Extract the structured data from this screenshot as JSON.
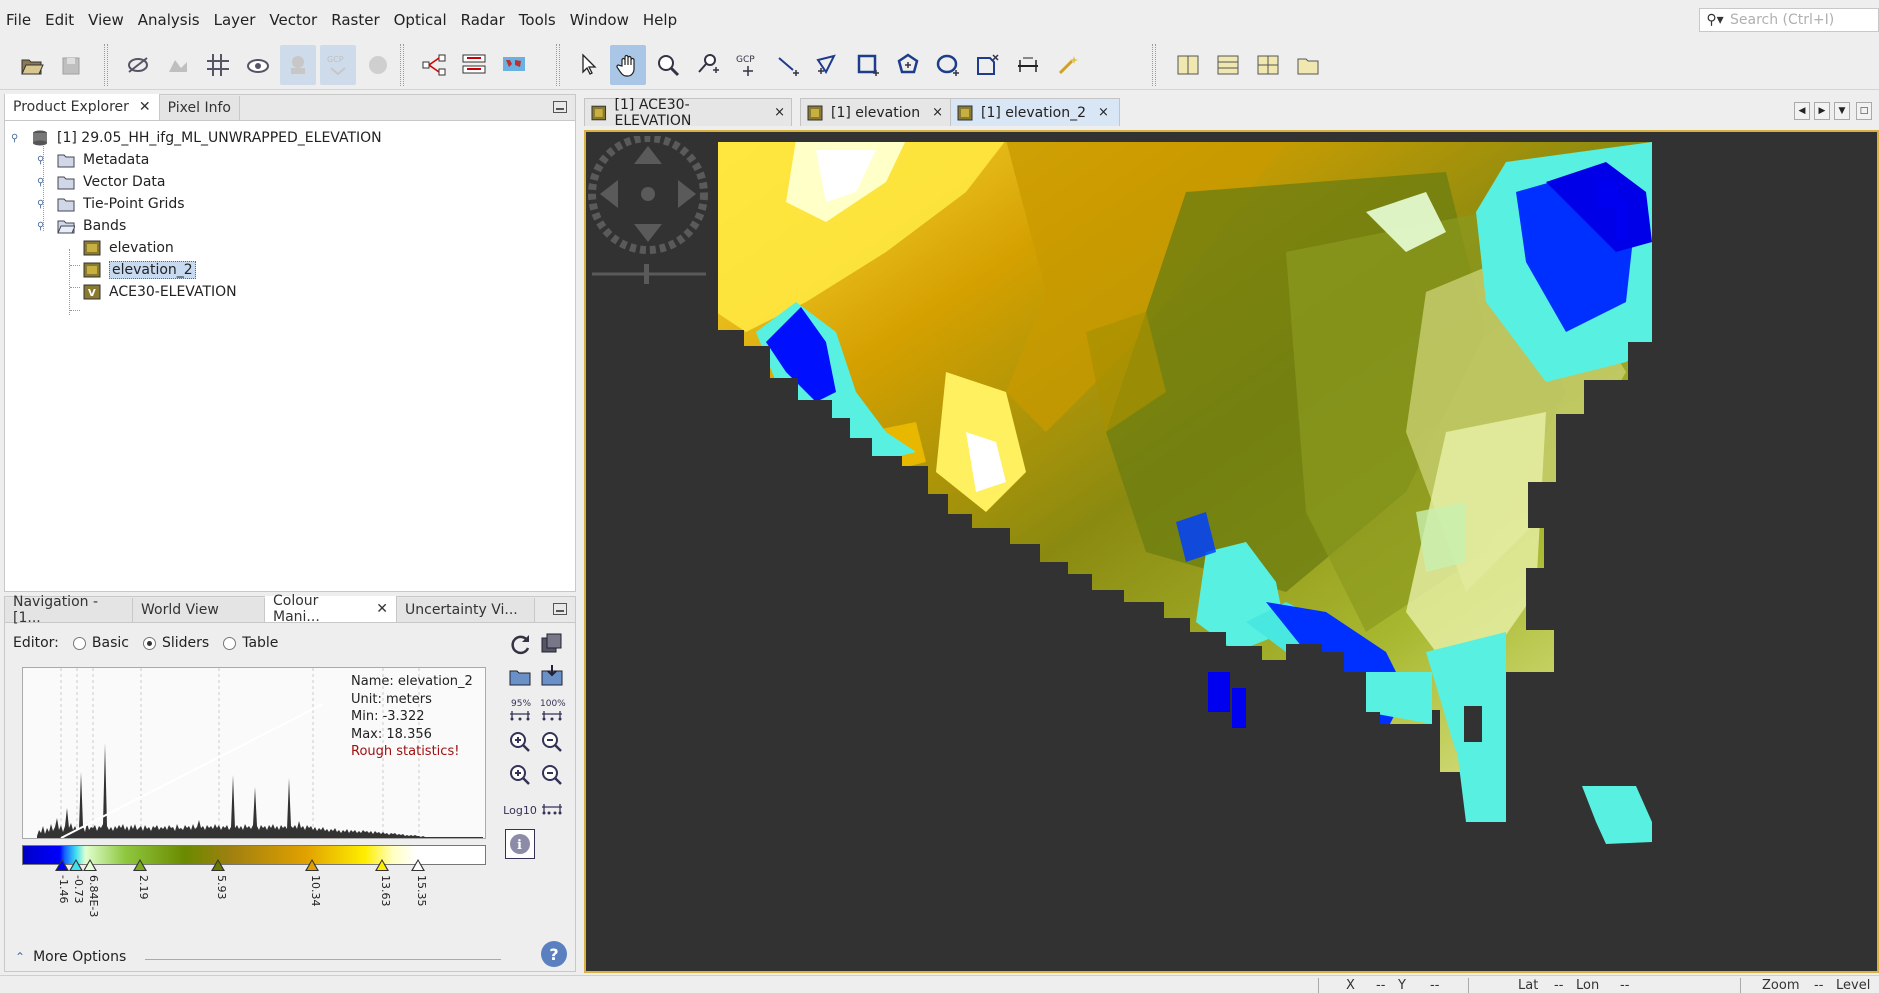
{
  "menubar": {
    "items": [
      {
        "label": "File"
      },
      {
        "label": "Edit"
      },
      {
        "label": "View"
      },
      {
        "label": "Analysis"
      },
      {
        "label": "Layer"
      },
      {
        "label": "Vector"
      },
      {
        "label": "Raster"
      },
      {
        "label": "Optical"
      },
      {
        "label": "Radar"
      },
      {
        "label": "Tools"
      },
      {
        "label": "Window"
      },
      {
        "label": "Help"
      }
    ],
    "search_placeholder": "Search (Ctrl+I)"
  },
  "explorer": {
    "tabs": [
      {
        "label": "Product Explorer"
      },
      {
        "label": "Pixel Info"
      }
    ],
    "product": "[1] 29.05_HH_ifg_ML_UNWRAPPED_ELEVATION",
    "folders": [
      {
        "label": "Metadata"
      },
      {
        "label": "Vector Data"
      },
      {
        "label": "Tie-Point Grids"
      },
      {
        "label": "Bands"
      }
    ],
    "bands": [
      {
        "label": "elevation"
      },
      {
        "label": "elevation_2"
      },
      {
        "label": "ACE30-ELEVATION"
      }
    ]
  },
  "lower_panel": {
    "tabs": [
      {
        "label": "Navigation - [1..."
      },
      {
        "label": "World View"
      },
      {
        "label": "Colour Mani..."
      },
      {
        "label": "Uncertainty Vi..."
      }
    ],
    "editor_label": "Editor:",
    "editor_options": [
      {
        "label": "Basic"
      },
      {
        "label": "Sliders"
      },
      {
        "label": "Table"
      }
    ],
    "editor_selected": "Sliders",
    "info": {
      "name": "Name: elevation_2",
      "unit": "Unit: meters",
      "min": "Min: -3.322",
      "max": "Max: 18.356",
      "warning": "Rough statistics!"
    },
    "sliders": [
      {
        "label": "-1.46",
        "color": "#0000ff"
      },
      {
        "label": "-0.73",
        "color": "#40e0f0"
      },
      {
        "label": "6.84E-3",
        "color": "#e8ffd8"
      },
      {
        "label": "2.19",
        "color": "#7aac20"
      },
      {
        "label": "5.93",
        "color": "#6a7a00"
      },
      {
        "label": "10.34",
        "color": "#e0a000"
      },
      {
        "label": "13.63",
        "color": "#ffee00"
      },
      {
        "label": "15.35",
        "color": "#ffffff"
      }
    ],
    "pct95": "95%",
    "pct100": "100%",
    "log_label": "Log10",
    "more_options": "More Options"
  },
  "view_tabs": [
    {
      "label": "[1] ACE30-ELEVATION"
    },
    {
      "label": "[1] elevation"
    },
    {
      "label": "[1] elevation_2"
    }
  ],
  "statusbar": {
    "x": "X",
    "dash1": "--",
    "y": "Y",
    "dash2": "--",
    "lat": "Lat",
    "dash3": "--",
    "lon": "Lon",
    "dash4": "--",
    "zoom": "Zoom",
    "dash5": "--",
    "level": "Level"
  }
}
